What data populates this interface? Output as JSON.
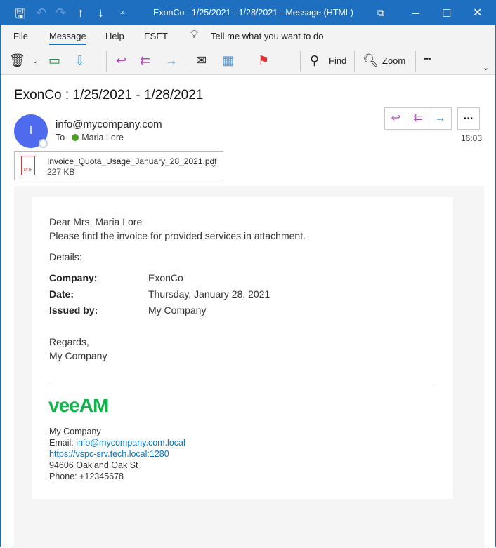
{
  "window": {
    "title": "ExonCo : 1/25/2021 - 1/28/2021  -  Message (HTML)"
  },
  "menu": {
    "file": "File",
    "message": "Message",
    "help": "Help",
    "eset": "ESET",
    "tell": "Tell me what you want to do"
  },
  "toolbar": {
    "find": "Find",
    "zoom": "Zoom",
    "more": "•••"
  },
  "message": {
    "subject": "ExonCo : 1/25/2021 - 1/28/2021",
    "avatar_initial": "I",
    "sender": "info@mycompany.com",
    "to_label": "To",
    "recipient": "Maria Lore",
    "time": "16:03"
  },
  "attachment": {
    "name": "Invoice_Quota_Usage_January_28_2021.pdf",
    "size": "227 KB",
    "type": "PDF"
  },
  "body": {
    "greeting": "Dear Mrs. Maria Lore",
    "intro": "Please find the invoice for provided services in attachment.",
    "details_label": "Details:",
    "details": [
      {
        "label": "Company:",
        "value": "ExonCo"
      },
      {
        "label": "Date:",
        "value": "Thursday, January 28, 2021"
      },
      {
        "label": "Issued by:",
        "value": "My Company"
      }
    ],
    "regards": "Regards,",
    "signoff": "My Company"
  },
  "signature": {
    "logo": "veeAM",
    "company": "My Company",
    "email_label": "Email: ",
    "email": "info@mycompany.com.local",
    "url": "https://vspc-srv.tech.local:1280",
    "address": "94606 Oakland Oak St",
    "phone": "Phone: +12345678"
  }
}
